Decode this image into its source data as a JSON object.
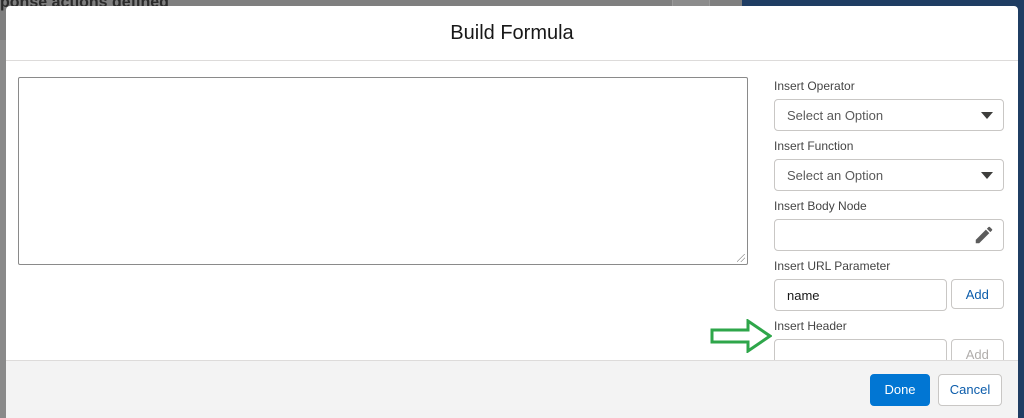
{
  "background": {
    "heading": "ponse actions defined"
  },
  "modal": {
    "title": "Build Formula",
    "formula_value": ""
  },
  "insert_operator": {
    "label": "Insert Operator",
    "selected": "Select an Option"
  },
  "insert_function": {
    "label": "Insert Function",
    "selected": "Select an Option"
  },
  "insert_body_node": {
    "label": "Insert Body Node",
    "value": ""
  },
  "insert_url_parameter": {
    "label": "Insert URL Parameter",
    "value": "name",
    "add_label": "Add"
  },
  "insert_header": {
    "label": "Insert Header",
    "value": "",
    "add_label": "Add"
  },
  "footer": {
    "done_label": "Done",
    "cancel_label": "Cancel"
  },
  "colors": {
    "brand": "#0176d3",
    "annotation_arrow": "#2ea64a"
  }
}
